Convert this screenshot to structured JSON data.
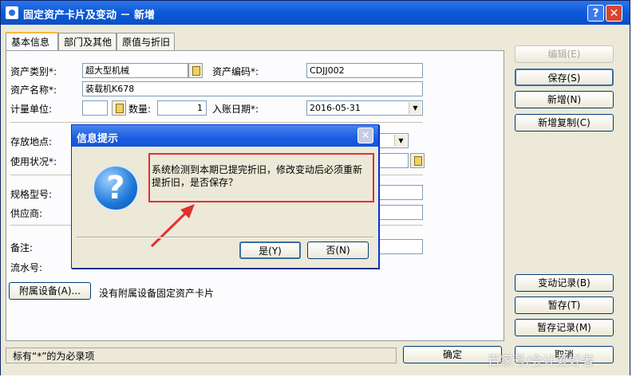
{
  "window": {
    "title": "固定资产卡片及变动 － 新增",
    "help_label": "?",
    "close_label": "✕"
  },
  "tabs": [
    "基本信息",
    "部门及其他",
    "原值与折旧"
  ],
  "form": {
    "category_label": "资产类别*:",
    "category_value": "超大型机械",
    "code_label": "资产编码*:",
    "code_value": "CDJJ002",
    "name_label": "资产名称*:",
    "name_value": "装载机K678",
    "unit_label": "计量单位:",
    "unit_value": "",
    "qty_label": "数量:",
    "qty_value": "1",
    "date_label": "入账日期*:",
    "date_value": "2016-05-31",
    "location_label": "存放地点:",
    "status_label": "使用状况*:",
    "spec_label": "规格型号:",
    "supplier_label": "供应商:",
    "remark_label": "备注:",
    "serial_label": "流水号:",
    "attach_button": "附属设备(A)...",
    "attach_note": "没有附属设备固定资产卡片"
  },
  "side_buttons": {
    "edit": "编辑(E)",
    "save": "保存(S)",
    "add": "新增(N)",
    "add_copy": "新增复制(C)",
    "change_log": "变动记录(B)",
    "temp_save": "暂存(T)",
    "temp_log": "暂存记录(M)"
  },
  "status": {
    "required_note": "标有“*”的为必录项",
    "ok": "确定",
    "cancel": "取消"
  },
  "dialog": {
    "title": "信息提示",
    "message": "系统检测到本期已提完折旧，修改变动后必须重新提折旧，是否保存？",
    "yes": "是(Y)",
    "no": "否(N)",
    "close_label": "✕"
  },
  "watermark": "百家号/会计爱好者",
  "colors": {
    "titlebar": "#0a5ad8",
    "highlight": "#e03030",
    "arrow": "#e03030"
  }
}
